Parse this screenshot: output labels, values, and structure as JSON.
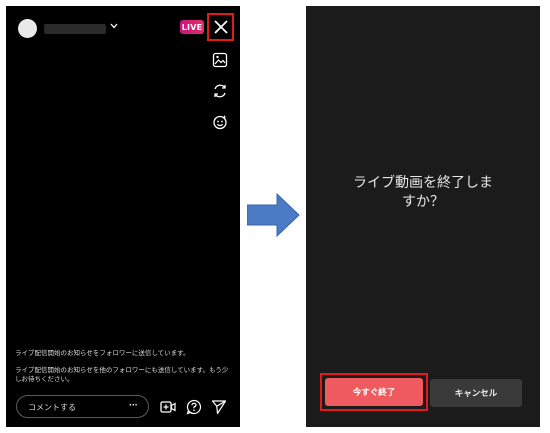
{
  "left_screen": {
    "live_badge": "LIVE",
    "notices": [
      "ライブ配信開始のお知らせをフォロワーに送信しています。",
      "ライブ配信開始のお知らせを他のフォロワーにも送信しています。もう少しお待ちください。"
    ],
    "comment_placeholder": "コメントする",
    "comment_more": "···",
    "icons": [
      "close-icon",
      "image-icon",
      "switch-camera-icon",
      "face-effect-icon",
      "add-video-icon",
      "question-icon",
      "send-icon"
    ]
  },
  "right_screen": {
    "dialog_title_line1": "ライブ動画を終了しま",
    "dialog_title_line2": "すか？",
    "end_now_label": "今すぐ終了",
    "cancel_label": "キャンセル"
  },
  "colors": {
    "highlight": "#e21a1a",
    "live_badge": "#c8157a",
    "end_button": "#ee5a5d",
    "cancel_button": "#3a3a3a",
    "arrow": "#4a7bc4"
  }
}
